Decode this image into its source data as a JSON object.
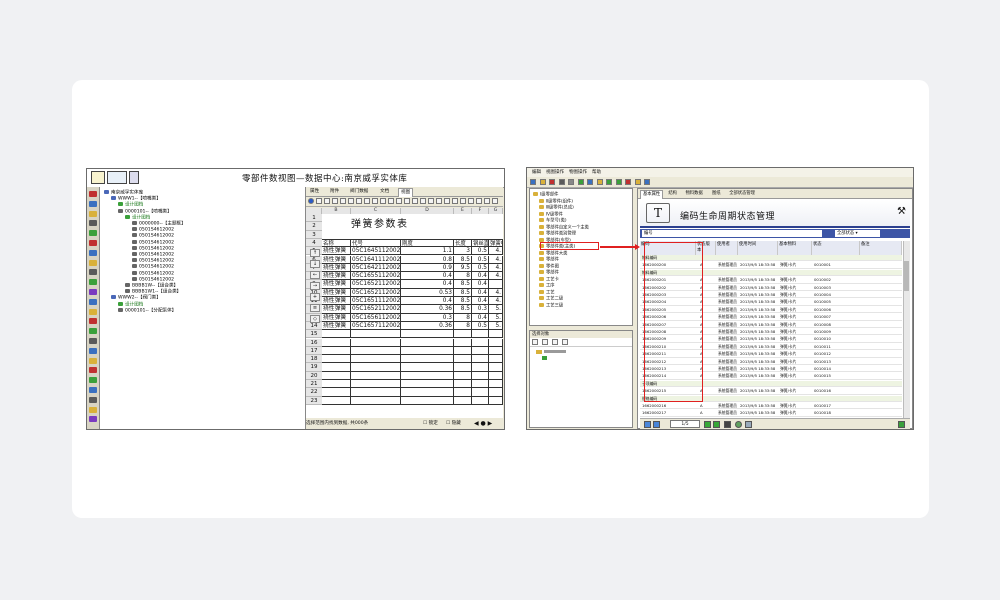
{
  "left_window": {
    "title": "零部件数视图—数据中心:南京威孚实体库",
    "tree": [
      {
        "label": "南京威孚实体库",
        "indent": 0,
        "color": "#000000"
      },
      {
        "label": "WWW1--【喷嘴类】",
        "indent": 1,
        "color": "#000000"
      },
      {
        "label": "设计图档",
        "indent": 2,
        "color": "#1c7a1c"
      },
      {
        "label": "0000101--【喷嘴类】",
        "indent": 2,
        "color": "#000000"
      },
      {
        "label": "设计图档",
        "indent": 3,
        "color": "#1c7a1c"
      },
      {
        "label": "0000000--【主题框】",
        "indent": 4,
        "color": "#000000"
      },
      {
        "label": "0501S4612002",
        "indent": 4,
        "color": "#000000"
      },
      {
        "label": "0501S4612002",
        "indent": 4,
        "color": "#000000"
      },
      {
        "label": "0501S4612002",
        "indent": 4,
        "color": "#000000"
      },
      {
        "label": "0501S4612002",
        "indent": 4,
        "color": "#000000"
      },
      {
        "label": "0501S4612002",
        "indent": 4,
        "color": "#000000"
      },
      {
        "label": "0501S4612002",
        "indent": 4,
        "color": "#000000"
      },
      {
        "label": "0501S4612002",
        "indent": 4,
        "color": "#000000"
      },
      {
        "label": "0501S4612002",
        "indent": 4,
        "color": "#000000"
      },
      {
        "label": "0501S4612002",
        "indent": 4,
        "color": "#000000"
      },
      {
        "label": "BBBB1W--【组合类】",
        "indent": 3,
        "color": "#000000"
      },
      {
        "label": "BBBB1W1--【组合类】",
        "indent": 3,
        "color": "#000000"
      },
      {
        "label": "WWW2--【阀门类】",
        "indent": 1,
        "color": "#000000"
      },
      {
        "label": "设计图档",
        "indent": 2,
        "color": "#1c7a1c"
      },
      {
        "label": "0000101--【分配泵体】",
        "indent": 2,
        "color": "#000000"
      }
    ],
    "tabs": [
      "属性",
      "附件",
      "阀门数据",
      "文档",
      "视图"
    ],
    "sheet": {
      "title": "弹簧参数表",
      "col_letters": [
        "",
        "B",
        "C",
        "D",
        "E",
        "F",
        "G"
      ],
      "headers": [
        "名称",
        "代号",
        "刚度",
        "长度",
        "钢丝直径",
        "弹簧中径"
      ],
      "rows": [
        [
          "挠性弹簧",
          "05C1645112002",
          "1.1",
          "3",
          "0.5",
          "4."
        ],
        [
          "挠性弹簧",
          "05C1641112002",
          "0.8",
          "8.5",
          "0.5",
          "4."
        ],
        [
          "挠性弹簧",
          "05C1642112002",
          "0.9",
          "9.5",
          "0.5",
          "4."
        ],
        [
          "挠性弹簧",
          "05C1655112002",
          "0.4",
          "8",
          "0.4",
          "4."
        ],
        [
          "挠性弹簧",
          "05C1652112002",
          "0.4",
          "8.5",
          "0.4",
          ""
        ],
        [
          "挠性弹簧",
          "05C1652112002",
          "0.53",
          "8.5",
          "0.4",
          "4."
        ],
        [
          "挠性弹簧",
          "05C1651112002",
          "0.4",
          "8.5",
          "0.4",
          "4."
        ],
        [
          "挠性弹簧",
          "05C1652112002",
          "0.36",
          "8.5",
          "0.3",
          "5."
        ],
        [
          "挠性弹簧",
          "05C1656112002",
          "0.3",
          "8",
          "0.4",
          "5."
        ],
        [
          "挠性弹簧",
          "05C1657112002",
          "0.36",
          "8",
          "0.5",
          "5."
        ]
      ],
      "row_count": 23
    },
    "status": "选择范围内找到数据, 共000条",
    "status_checks": [
      "锁定",
      "隐藏"
    ]
  },
  "right_window": {
    "menu": [
      "编辑",
      "视图操作",
      "物图操作",
      "帮助"
    ],
    "tree": [
      {
        "label": "Ⅰ级零部件",
        "indent": 0
      },
      {
        "label": "Ⅱ级零件(组件)",
        "indent": 1
      },
      {
        "label": "Ⅲ级零件(总成)",
        "indent": 1
      },
      {
        "label": "Ⅳ级零件",
        "indent": 1
      },
      {
        "label": "车型号(类)",
        "indent": 1
      },
      {
        "label": "零部件自定义一个主类",
        "indent": 1
      },
      {
        "label": "零部件类别管理",
        "indent": 1
      },
      {
        "label": "零部件(车型)",
        "indent": 1
      },
      {
        "label": "零部件类(主类)",
        "indent": 1
      },
      {
        "label": "零部件大类",
        "indent": 1
      },
      {
        "label": "零部件",
        "indent": 1
      },
      {
        "label": "零件图",
        "indent": 1
      },
      {
        "label": "零部件",
        "indent": 1
      },
      {
        "label": "工艺卡",
        "indent": 1
      },
      {
        "label": "工序",
        "indent": 1
      },
      {
        "label": "工艺",
        "indent": 1
      },
      {
        "label": "工艺二级",
        "indent": 1
      },
      {
        "label": "工艺三级",
        "indent": 1
      }
    ],
    "lower_panel_title": "选择对象",
    "tabs": [
      "基本属性",
      "结构",
      "物料数据",
      "图纸",
      "全部状态管理"
    ],
    "banner_title": "编码生命周期状态管理",
    "search_placeholder": "编号",
    "filter_value": "全部状态",
    "columns": [
      "编码",
      "状态版本",
      "使用者",
      "使用时间",
      "基本物料",
      "状态",
      "备注"
    ],
    "rows": [
      {
        "group": true,
        "code": "物料编码"
      },
      {
        "group": false,
        "code": "1662000200",
        "ver": "A",
        "user": "系统管理员",
        "time": "2013/9/5 18:33:58",
        "mat": "弹簧/卡片",
        "status": "0010001"
      },
      {
        "group": true,
        "code": "物料编码"
      },
      {
        "group": false,
        "code": "1662000201",
        "ver": "A",
        "user": "系统管理员",
        "time": "2013/9/5 18:33:58",
        "mat": "弹簧/卡片",
        "status": "0010002"
      },
      {
        "group": false,
        "code": "1662000202",
        "ver": "A",
        "user": "系统管理员",
        "time": "2013/9/5 18:33:58",
        "mat": "弹簧/卡片",
        "status": "0010003"
      },
      {
        "group": false,
        "code": "1662000203",
        "ver": "A",
        "user": "系统管理员",
        "time": "2013/9/5 18:33:58",
        "mat": "弹簧/卡片",
        "status": "0010004"
      },
      {
        "group": false,
        "code": "1662000204",
        "ver": "A",
        "user": "系统管理员",
        "time": "2013/9/5 18:33:58",
        "mat": "弹簧/卡片",
        "status": "0010005"
      },
      {
        "group": false,
        "code": "1662000205",
        "ver": "A",
        "user": "系统管理员",
        "time": "2013/9/5 18:33:58",
        "mat": "弹簧/卡片",
        "status": "0010006"
      },
      {
        "group": false,
        "code": "1662000206",
        "ver": "A",
        "user": "系统管理员",
        "time": "2013/9/5 18:33:58",
        "mat": "弹簧/卡片",
        "status": "0010007"
      },
      {
        "group": false,
        "code": "1662000207",
        "ver": "A",
        "user": "系统管理员",
        "time": "2013/9/5 18:33:58",
        "mat": "弹簧/卡片",
        "status": "0010008"
      },
      {
        "group": false,
        "code": "1662000208",
        "ver": "A",
        "user": "系统管理员",
        "time": "2013/9/5 18:33:58",
        "mat": "弹簧/卡片",
        "status": "0010009"
      },
      {
        "group": false,
        "code": "1662000209",
        "ver": "A",
        "user": "系统管理员",
        "time": "2013/9/5 18:33:58",
        "mat": "弹簧/卡片",
        "status": "0010010"
      },
      {
        "group": false,
        "code": "1662000210",
        "ver": "A",
        "user": "系统管理员",
        "time": "2013/9/5 18:33:58",
        "mat": "弹簧/卡片",
        "status": "0010011"
      },
      {
        "group": false,
        "code": "1662000211",
        "ver": "A",
        "user": "系统管理员",
        "time": "2013/9/5 18:33:58",
        "mat": "弹簧/卡片",
        "status": "0010012"
      },
      {
        "group": false,
        "code": "1662000212",
        "ver": "A",
        "user": "系统管理员",
        "time": "2013/9/5 18:33:58",
        "mat": "弹簧/卡片",
        "status": "0010013"
      },
      {
        "group": false,
        "code": "1662000213",
        "ver": "A",
        "user": "系统管理员",
        "time": "2013/9/5 18:33:58",
        "mat": "弹簧/卡片",
        "status": "0010014"
      },
      {
        "group": false,
        "code": "1662000214",
        "ver": "A",
        "user": "系统管理员",
        "time": "2013/9/5 18:33:58",
        "mat": "弹簧/卡片",
        "status": "0010015"
      },
      {
        "group": true,
        "code": "子项编码"
      },
      {
        "group": false,
        "code": "1662000215",
        "ver": "A",
        "user": "系统管理员",
        "time": "2013/9/5 18:33:58",
        "mat": "弹簧/卡片",
        "status": "0010016"
      },
      {
        "group": true,
        "code": "规格编码"
      },
      {
        "group": false,
        "code": "1662000216",
        "ver": "A",
        "user": "系统管理员",
        "time": "2013/9/5 18:33:58",
        "mat": "弹簧/卡片",
        "status": "0010017"
      },
      {
        "group": false,
        "code": "1662000217",
        "ver": "A",
        "user": "系统管理员",
        "time": "2013/9/5 18:33:58",
        "mat": "弹簧/卡片",
        "status": "0010018"
      }
    ],
    "pager": "1/5",
    "accent_color": "#3d55a6",
    "highlight_color": "#e02020"
  }
}
